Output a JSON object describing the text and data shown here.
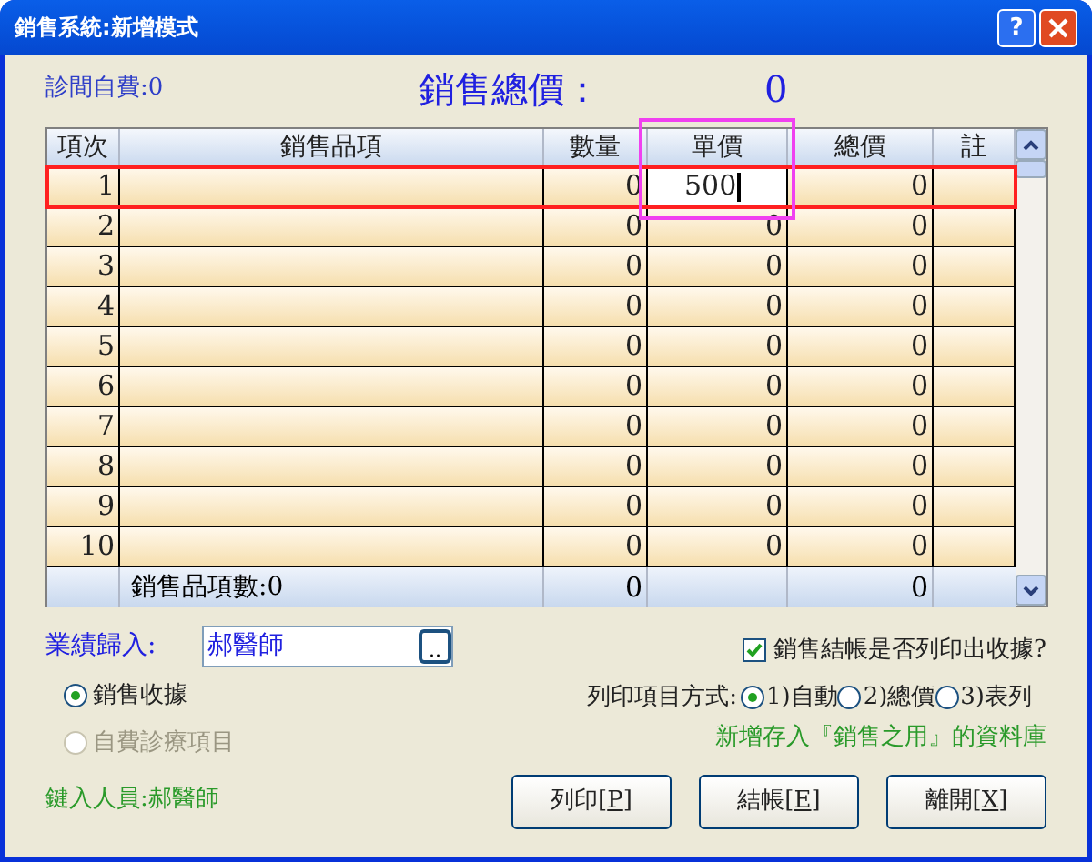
{
  "window": {
    "title": "銷售系統:新增模式",
    "help_button": "?"
  },
  "clinic_self_pay": "診間自費:0",
  "total_label": "銷售總價：",
  "total_value": "0",
  "table": {
    "columns": [
      {
        "label": "項次",
        "highlighted": false
      },
      {
        "label": "銷售品項",
        "highlighted": false
      },
      {
        "label": "數量",
        "highlighted": false
      },
      {
        "label": "單價",
        "highlighted": true
      },
      {
        "label": "總價",
        "highlighted": false
      },
      {
        "label": "註",
        "highlighted": false
      }
    ],
    "rows": [
      {
        "no": "1",
        "item": "",
        "qty": "0",
        "price": "500",
        "total": "0",
        "selected": true,
        "editing": true
      },
      {
        "no": "2",
        "item": "",
        "qty": "0",
        "price": "0",
        "total": "0",
        "selected": false,
        "editing": false
      },
      {
        "no": "3",
        "item": "",
        "qty": "0",
        "price": "0",
        "total": "0",
        "selected": false,
        "editing": false
      },
      {
        "no": "4",
        "item": "",
        "qty": "0",
        "price": "0",
        "total": "0",
        "selected": false,
        "editing": false
      },
      {
        "no": "5",
        "item": "",
        "qty": "0",
        "price": "0",
        "total": "0",
        "selected": false,
        "editing": false
      },
      {
        "no": "6",
        "item": "",
        "qty": "0",
        "price": "0",
        "total": "0",
        "selected": false,
        "editing": false
      },
      {
        "no": "7",
        "item": "",
        "qty": "0",
        "price": "0",
        "total": "0",
        "selected": false,
        "editing": false
      },
      {
        "no": "8",
        "item": "",
        "qty": "0",
        "price": "0",
        "total": "0",
        "selected": false,
        "editing": false
      },
      {
        "no": "9",
        "item": "",
        "qty": "0",
        "price": "0",
        "total": "0",
        "selected": false,
        "editing": false
      },
      {
        "no": "10",
        "item": "",
        "qty": "0",
        "price": "0",
        "total": "0",
        "selected": false,
        "editing": false
      }
    ],
    "footer": {
      "count": "銷售品項數:0",
      "qty": "0",
      "total": "0"
    }
  },
  "performance": {
    "label": "業績歸入:",
    "value": "郝醫師",
    "browse_button": ".."
  },
  "receipt_types": [
    {
      "label": "銷售收據",
      "selected": true,
      "disabled": false
    },
    {
      "label": "自費診療項目",
      "selected": false,
      "disabled": true
    }
  ],
  "print_receipt": {
    "label": "銷售結帳是否列印出收據?",
    "checked": true
  },
  "print_mode": {
    "label": "列印項目方式:",
    "options": [
      {
        "label": "1)自動",
        "selected": true
      },
      {
        "label": "2)總價",
        "selected": false
      },
      {
        "label": "3)表列",
        "selected": false
      }
    ]
  },
  "save_note": "新增存入『銷售之用』的資料庫",
  "operator": "鍵入人員:郝醫師",
  "buttons": [
    {
      "prefix": "列印[",
      "hotkey": "P",
      "suffix": "]"
    },
    {
      "prefix": "結帳[",
      "hotkey": "E",
      "suffix": "]"
    },
    {
      "prefix": "離開[",
      "hotkey": "X",
      "suffix": "]"
    }
  ]
}
